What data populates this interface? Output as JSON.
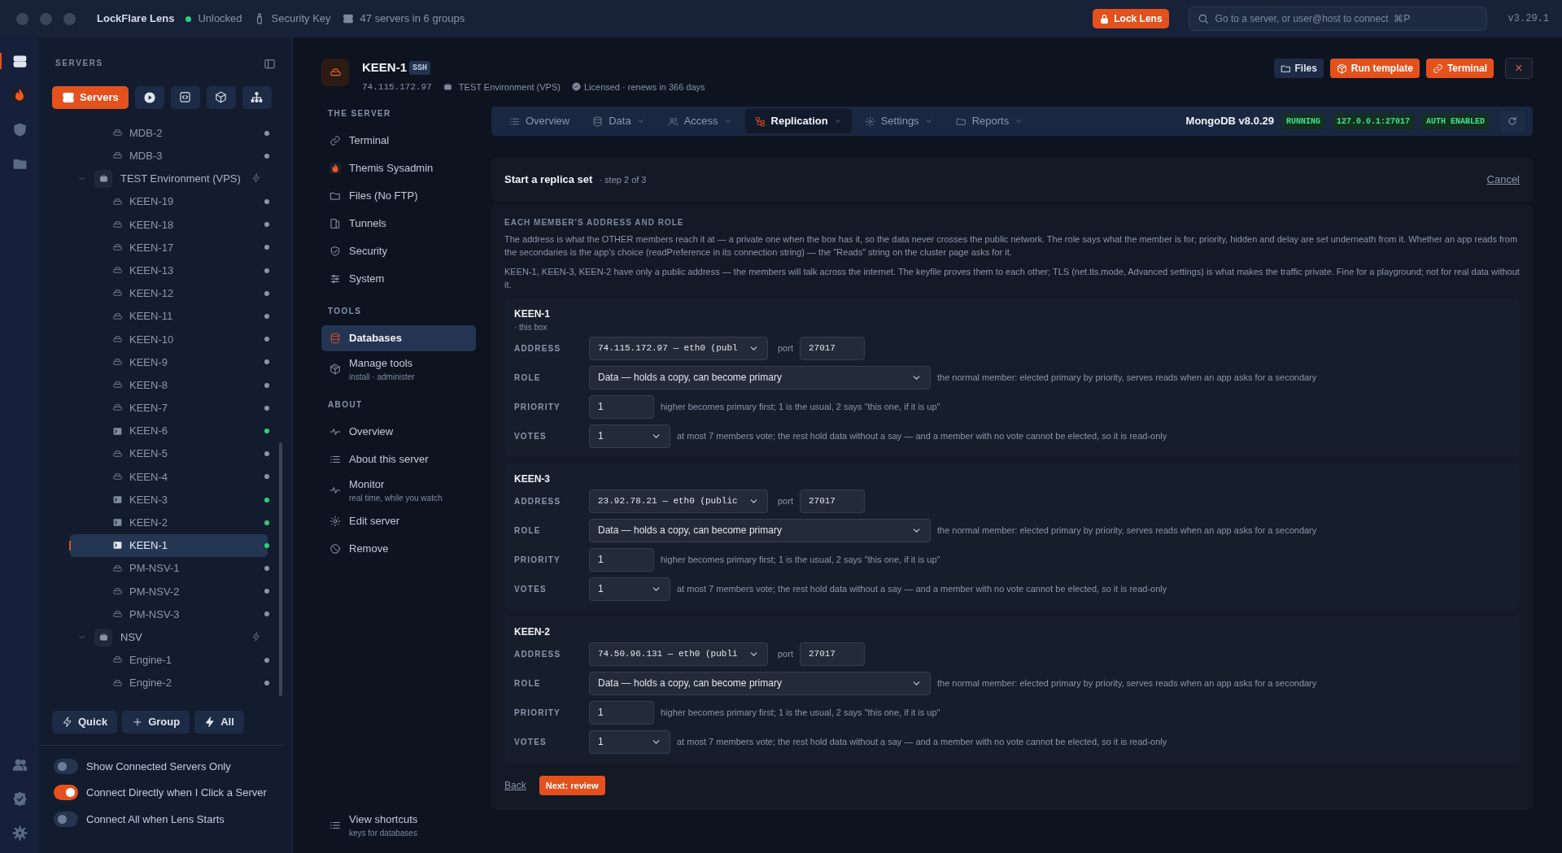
{
  "titlebar": {
    "app_name": "LockFlare Lens",
    "lock_state": {
      "label": "Unlocked",
      "unlocked": true
    },
    "security_key": "Security Key",
    "servers_summary": "47 servers in 6 groups",
    "lock_button": "Lock Lens",
    "search": {
      "placeholder": "Go to a server, or user@host to connect  ⌘P"
    },
    "version": "v3.29.1"
  },
  "rail": [
    {
      "selected": true
    },
    {
      "selected": false
    },
    {
      "selected": false
    },
    {
      "selected": false
    }
  ],
  "sidebar": {
    "title": "SERVERS",
    "modes": [
      {
        "label": "Servers",
        "selected": true
      },
      {
        "selected": false
      },
      {
        "selected": false
      },
      {
        "selected": false
      },
      {
        "selected": false
      }
    ],
    "tree": [
      {
        "kind": "server",
        "name": "MDB-2",
        "connected": false,
        "selected": false
      },
      {
        "kind": "server",
        "name": "MDB-3",
        "connected": false,
        "selected": false
      },
      {
        "kind": "group",
        "name": "TEST Environment (VPS)",
        "expanded": true,
        "children": [
          {
            "kind": "server",
            "name": "KEEN-19",
            "connected": false,
            "selected": false
          },
          {
            "kind": "server",
            "name": "KEEN-18",
            "connected": false,
            "selected": false
          },
          {
            "kind": "server",
            "name": "KEEN-17",
            "connected": false,
            "selected": false
          },
          {
            "kind": "server",
            "name": "KEEN-13",
            "connected": false,
            "selected": false
          },
          {
            "kind": "server",
            "name": "KEEN-12",
            "connected": false,
            "selected": false
          },
          {
            "kind": "server",
            "name": "KEEN-11",
            "connected": false,
            "selected": false
          },
          {
            "kind": "server",
            "name": "KEEN-10",
            "connected": false,
            "selected": false
          },
          {
            "kind": "server",
            "name": "KEEN-9",
            "connected": false,
            "selected": false
          },
          {
            "kind": "server",
            "name": "KEEN-8",
            "connected": false,
            "selected": false
          },
          {
            "kind": "server",
            "name": "KEEN-7",
            "connected": false,
            "selected": false
          },
          {
            "kind": "server",
            "name": "KEEN-6",
            "connected": true,
            "selected": false
          },
          {
            "kind": "server",
            "name": "KEEN-5",
            "connected": false,
            "selected": false
          },
          {
            "kind": "server",
            "name": "KEEN-4",
            "connected": false,
            "selected": false
          },
          {
            "kind": "server",
            "name": "KEEN-3",
            "connected": true,
            "selected": false
          },
          {
            "kind": "server",
            "name": "KEEN-2",
            "connected": true,
            "selected": false
          },
          {
            "kind": "server",
            "name": "KEEN-1",
            "connected": true,
            "selected": true
          },
          {
            "kind": "server",
            "name": "PM-NSV-1",
            "connected": false,
            "selected": false
          },
          {
            "kind": "server",
            "name": "PM-NSV-2",
            "connected": false,
            "selected": false
          },
          {
            "kind": "server",
            "name": "PM-NSV-3",
            "connected": false,
            "selected": false
          }
        ]
      },
      {
        "kind": "group",
        "name": "NSV",
        "expanded": true,
        "children": [
          {
            "kind": "server",
            "name": "Engine-1",
            "connected": false,
            "selected": false
          },
          {
            "kind": "server",
            "name": "Engine-2",
            "connected": false,
            "selected": false
          }
        ]
      }
    ],
    "actions": [
      "Quick",
      "Group",
      "All"
    ],
    "toggles": [
      {
        "label": "Show Connected Servers Only",
        "on": false
      },
      {
        "label": "Connect Directly when I Click a Server",
        "on": true
      },
      {
        "label": "Connect All when Lens Starts",
        "on": false
      }
    ]
  },
  "server": {
    "name": "KEEN-1",
    "badge": "SSH",
    "address": "74.115.172.97",
    "group": "TEST Environment (VPS)",
    "license": "Licensed · renews in 366 days",
    "actions": [
      {
        "label": "Files",
        "kind": "plain"
      },
      {
        "label": "Run template",
        "kind": "accent"
      },
      {
        "label": "Terminal",
        "kind": "accent"
      },
      {
        "label": "×",
        "kind": "close"
      }
    ]
  },
  "nav": [
    {
      "title": "THE SERVER",
      "items": [
        {
          "label": "Terminal",
          "selected": false
        },
        {
          "label": "Themis Sysadmin",
          "selected": false
        },
        {
          "label": "Files (No FTP)",
          "selected": false
        },
        {
          "label": "Tunnels",
          "selected": false
        },
        {
          "label": "Security",
          "selected": false
        },
        {
          "label": "System",
          "selected": false
        }
      ]
    },
    {
      "title": "TOOLS",
      "items": [
        {
          "label": "Databases",
          "selected": true
        },
        {
          "label": "Manage tools",
          "sub": "install · administer",
          "selected": false
        }
      ]
    },
    {
      "title": "ABOUT",
      "items": [
        {
          "label": "Overview",
          "selected": false
        },
        {
          "label": "About this server",
          "selected": false
        },
        {
          "label": "Monitor",
          "sub": "real time, while you watch",
          "selected": false
        },
        {
          "label": "Edit server",
          "selected": false
        },
        {
          "label": "Remove",
          "selected": false
        }
      ]
    }
  ],
  "shortcuts": {
    "label": "View shortcuts",
    "sub": "keys for databases"
  },
  "tabs": [
    {
      "label": "Overview",
      "selected": false,
      "dropdown": false
    },
    {
      "label": "Data",
      "selected": false,
      "dropdown": true
    },
    {
      "label": "Access",
      "selected": false,
      "dropdown": true
    },
    {
      "label": "Replication",
      "selected": true,
      "dropdown": true
    },
    {
      "label": "Settings",
      "selected": false,
      "dropdown": true
    },
    {
      "label": "Reports",
      "selected": false,
      "dropdown": true
    }
  ],
  "db_status": {
    "product": "MongoDB v8.0.29",
    "badges": [
      "RUNNING",
      "127.0.0.1:27017",
      "AUTH ENABLED"
    ]
  },
  "wizard": {
    "title": "Start a replica set",
    "step": "· step 2 of 3",
    "cancel": "Cancel",
    "section_title": "EACH MEMBER'S ADDRESS AND ROLE",
    "paragraphs": [
      "The address is what the OTHER members reach it at — a private one when the box has it, so the data never crosses the public network. The role says what the member is for; priority, hidden and delay are set underneath from it. Whether an app reads from the secondaries is the app's choice (readPreference in its connection string) — the \"Reads\" string on the cluster page asks for it.",
      "KEEN-1, KEEN-3, KEEN-2 have only a public address — the members will talk across the internet. The keyfile proves them to each other; TLS (net.tls.mode, Advanced settings) is what makes the traffic private. Fine for a playground; not for real data without it."
    ],
    "members": [
      {
        "name": "KEEN-1",
        "note": "· this box",
        "rows": [
          {
            "kind": "address",
            "label": "ADDRESS",
            "value": "74.115.172.97 — eth0 (publ",
            "port_label": "port",
            "port": "27017"
          },
          {
            "kind": "select",
            "label": "ROLE",
            "value": "Data — holds a copy, can become primary",
            "hint": "the normal member: elected primary by priority, serves reads when an app asks for a secondary"
          },
          {
            "kind": "input",
            "label": "PRIORITY",
            "value": "1",
            "hint": "higher becomes primary first; 1 is the usual, 2 says \"this one, if it is up\""
          },
          {
            "kind": "small-select",
            "label": "VOTES",
            "value": "1",
            "hint": "at most 7 members vote; the rest hold data without a say — and a member with no vote cannot be elected, so it is read-only"
          }
        ]
      },
      {
        "name": "KEEN-3",
        "rows": [
          {
            "kind": "address",
            "label": "ADDRESS",
            "value": "23.92.78.21 — eth0 (public",
            "port_label": "port",
            "port": "27017"
          },
          {
            "kind": "select",
            "label": "ROLE",
            "value": "Data — holds a copy, can become primary",
            "hint": "the normal member: elected primary by priority, serves reads when an app asks for a secondary"
          },
          {
            "kind": "input",
            "label": "PRIORITY",
            "value": "1",
            "hint": "higher becomes primary first; 1 is the usual, 2 says \"this one, if it is up\""
          },
          {
            "kind": "small-select",
            "label": "VOTES",
            "value": "1",
            "hint": "at most 7 members vote; the rest hold data without a say — and a member with no vote cannot be elected, so it is read-only"
          }
        ]
      },
      {
        "name": "KEEN-2",
        "rows": [
          {
            "kind": "address",
            "label": "ADDRESS",
            "value": "74.50.96.131 — eth0 (publi",
            "port_label": "port",
            "port": "27017"
          },
          {
            "kind": "select",
            "label": "ROLE",
            "value": "Data — holds a copy, can become primary",
            "hint": "the normal member: elected primary by priority, serves reads when an app asks for a secondary"
          },
          {
            "kind": "input",
            "label": "PRIORITY",
            "value": "1",
            "hint": "higher becomes primary first; 1 is the usual, 2 says \"this one, if it is up\""
          },
          {
            "kind": "small-select",
            "label": "VOTES",
            "value": "1",
            "hint": "at most 7 members vote; the rest hold data without a say — and a member with no vote cannot be elected, so it is read-only"
          }
        ]
      }
    ],
    "back": "Back",
    "next": "Next: review"
  }
}
